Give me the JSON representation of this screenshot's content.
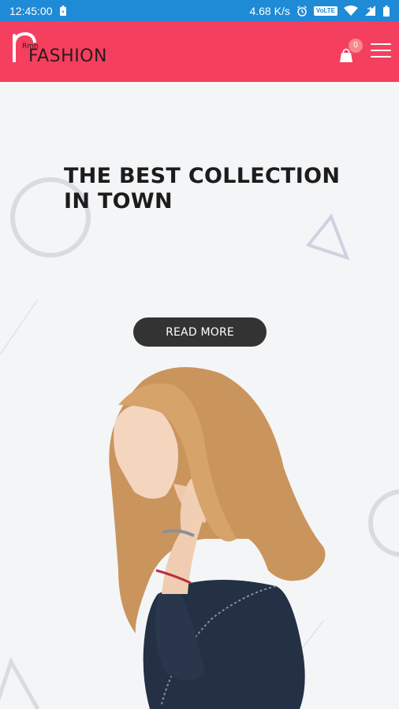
{
  "status_bar": {
    "time": "12:45:00",
    "network_speed": "4.68 K/s",
    "volte": "VoLTE"
  },
  "header": {
    "logo_small": "Rmh",
    "logo_text": "FASHION",
    "cart_count": "0"
  },
  "hero": {
    "headline": "THE BEST COLLECTION IN TOWN",
    "button_label": "READ MORE"
  },
  "colors": {
    "status_bar": "#1f8ad6",
    "header": "#f53f5f",
    "badge": "#f7878f",
    "button": "#333333",
    "background": "#f4f5f7"
  }
}
